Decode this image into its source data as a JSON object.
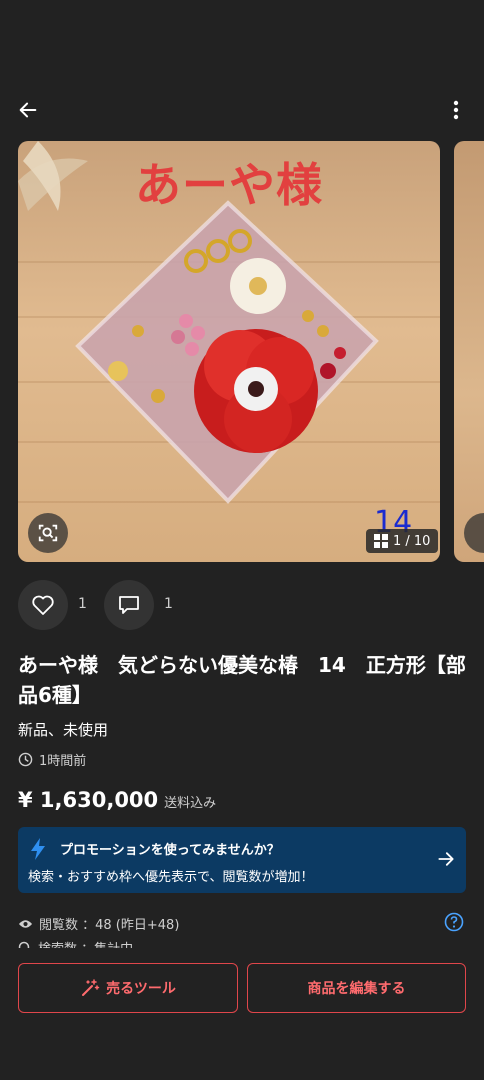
{
  "header": {
    "back_icon": "arrow-left-icon",
    "more_icon": "more-vertical-icon"
  },
  "gallery": {
    "caption": "あーや様",
    "number_overlay": "14",
    "counter": "1 / 10",
    "lens_icon": "image-search-icon",
    "grid_icon": "grid-icon"
  },
  "actions": {
    "like_count": "1",
    "comment_count": "1"
  },
  "item": {
    "title": "あーや様　気どらない優美な椿　14　正方形【部品6種】",
    "condition": "新品、未使用",
    "posted": "1時間前",
    "price": "¥ 1,630,000",
    "price_note": "送料込み"
  },
  "promo": {
    "title": "プロモーションを使ってみませんか？",
    "text": "検索・おすすめ枠へ優先表示で、閲覧数が増加！"
  },
  "stats": {
    "views": "閲覧数 ：48 (昨日+48)",
    "searches": "検索数 ：集計中"
  },
  "bottom": {
    "sell_tools": "売るツール",
    "edit_item": "商品を編集する"
  },
  "colors": {
    "background": "#222222",
    "accent_red": "#e0464b",
    "promo_blue": "#0c3a63",
    "caption_red": "#e2403f"
  }
}
